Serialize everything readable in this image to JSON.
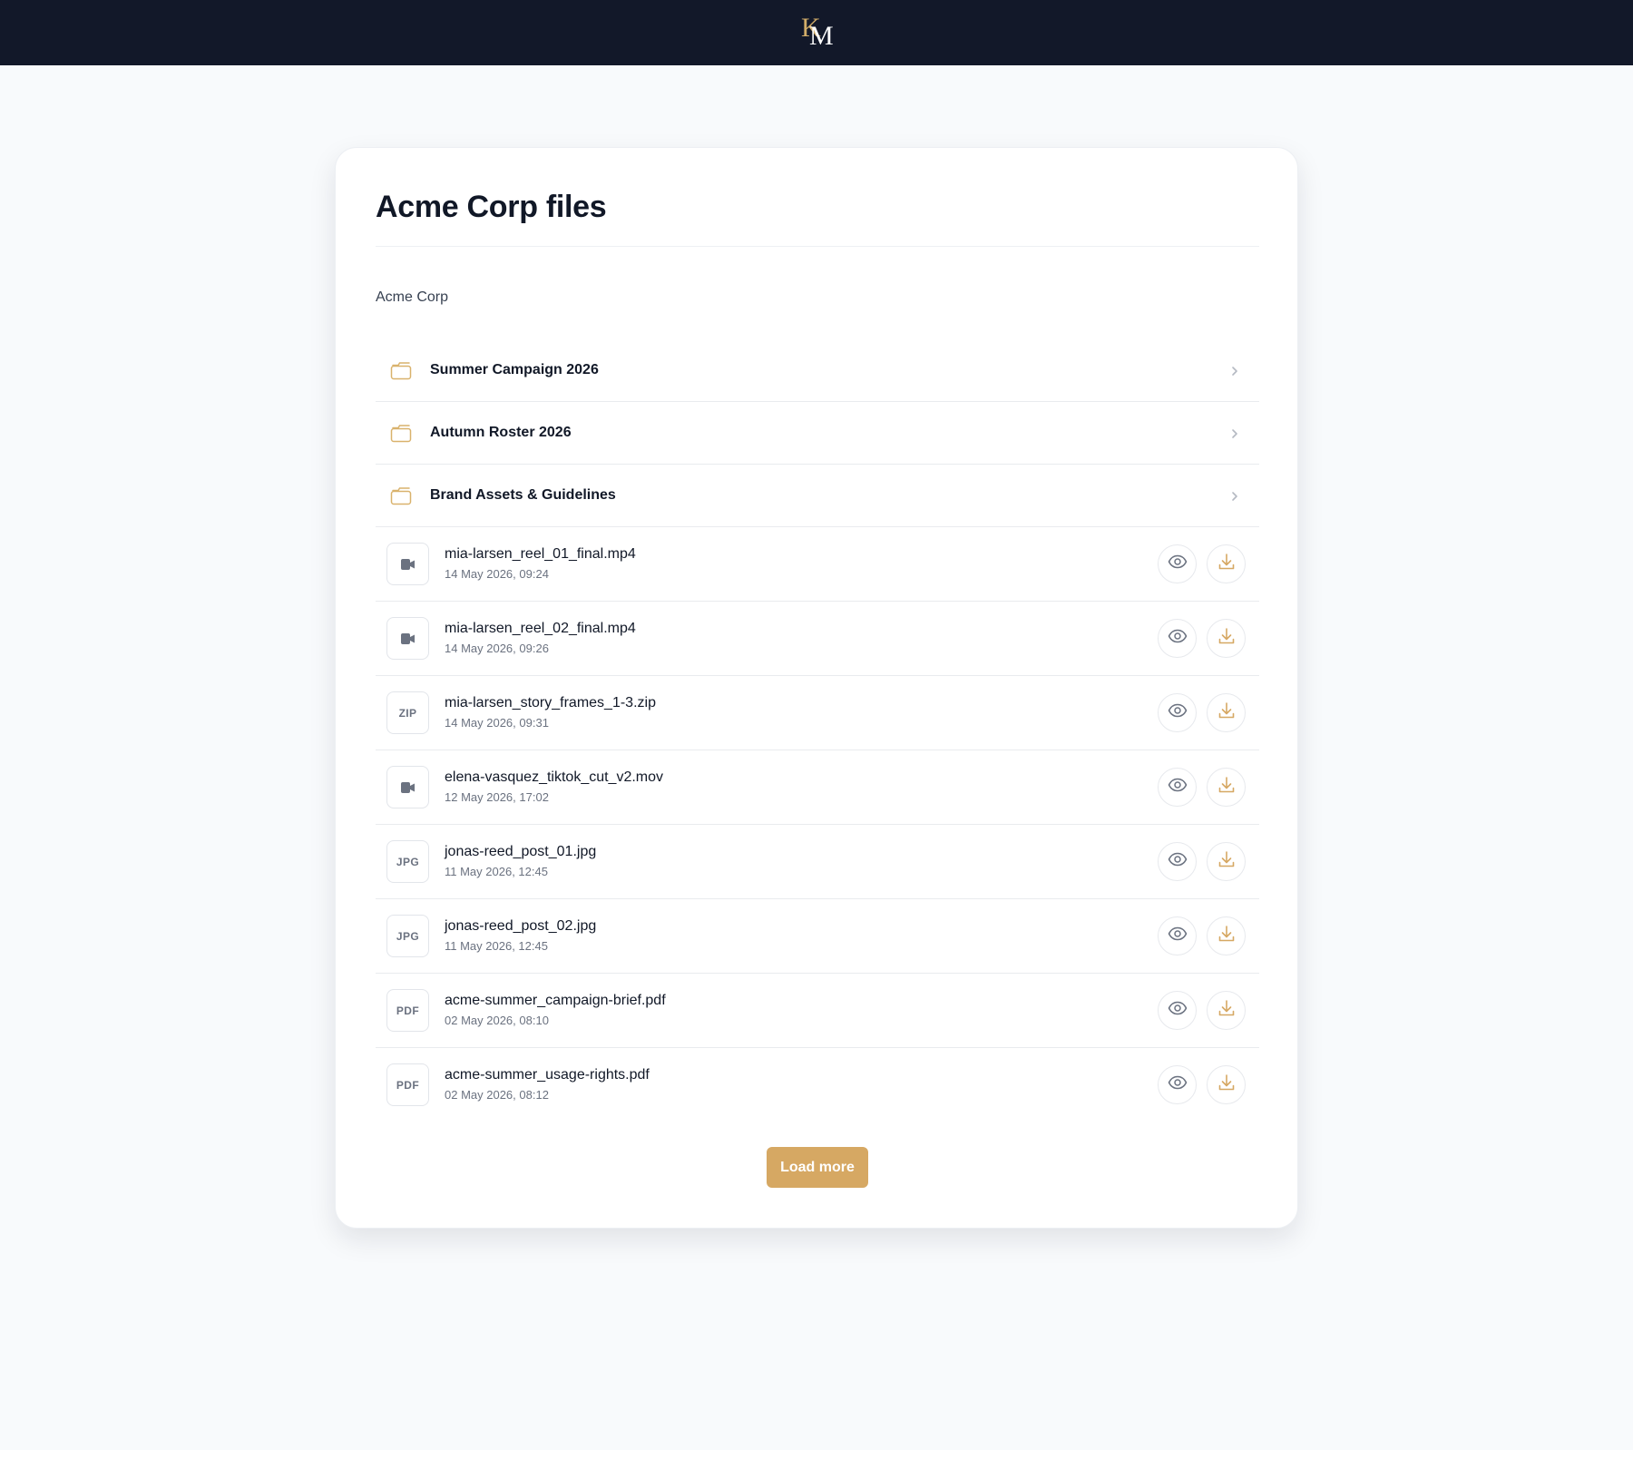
{
  "header": {
    "logo_letters": "KM",
    "logo_k": "K",
    "logo_m": "M"
  },
  "page": {
    "title": "Acme Corp files",
    "breadcrumb": "Acme Corp"
  },
  "folders": [
    {
      "name": "Summer Campaign 2026"
    },
    {
      "name": "Autumn Roster 2026"
    },
    {
      "name": "Brand Assets & Guidelines"
    }
  ],
  "files": [
    {
      "type_label": "",
      "icon": "video-icon",
      "name": "mia-larsen_reel_01_final.mp4",
      "date": "14 May 2026, 09:24"
    },
    {
      "type_label": "",
      "icon": "video-icon",
      "name": "mia-larsen_reel_02_final.mp4",
      "date": "14 May 2026, 09:26"
    },
    {
      "type_label": "ZIP",
      "icon": "zip-icon",
      "name": "mia-larsen_story_frames_1-3.zip",
      "date": "14 May 2026, 09:31"
    },
    {
      "type_label": "",
      "icon": "video-icon",
      "name": "elena-vasquez_tiktok_cut_v2.mov",
      "date": "12 May 2026, 17:02"
    },
    {
      "type_label": "JPG",
      "icon": "jpg-icon",
      "name": "jonas-reed_post_01.jpg",
      "date": "11 May 2026, 12:45"
    },
    {
      "type_label": "JPG",
      "icon": "jpg-icon",
      "name": "jonas-reed_post_02.jpg",
      "date": "11 May 2026, 12:45"
    },
    {
      "type_label": "PDF",
      "icon": "pdf-icon",
      "name": "acme-summer_campaign-brief.pdf",
      "date": "02 May 2026, 08:10"
    },
    {
      "type_label": "PDF",
      "icon": "pdf-icon",
      "name": "acme-summer_usage-rights.pdf",
      "date": "02 May 2026, 08:12"
    }
  ],
  "actions": {
    "load_more": "Load more"
  },
  "colors": {
    "topbar": "#121829",
    "accent_gold": "#d6a863",
    "folder_icon": "#d9b26c",
    "border": "#e9ebee"
  },
  "icons": {
    "folder": "folder-icon",
    "chevron": "chevron-right-icon",
    "view": "eye-icon",
    "download": "download-icon"
  }
}
